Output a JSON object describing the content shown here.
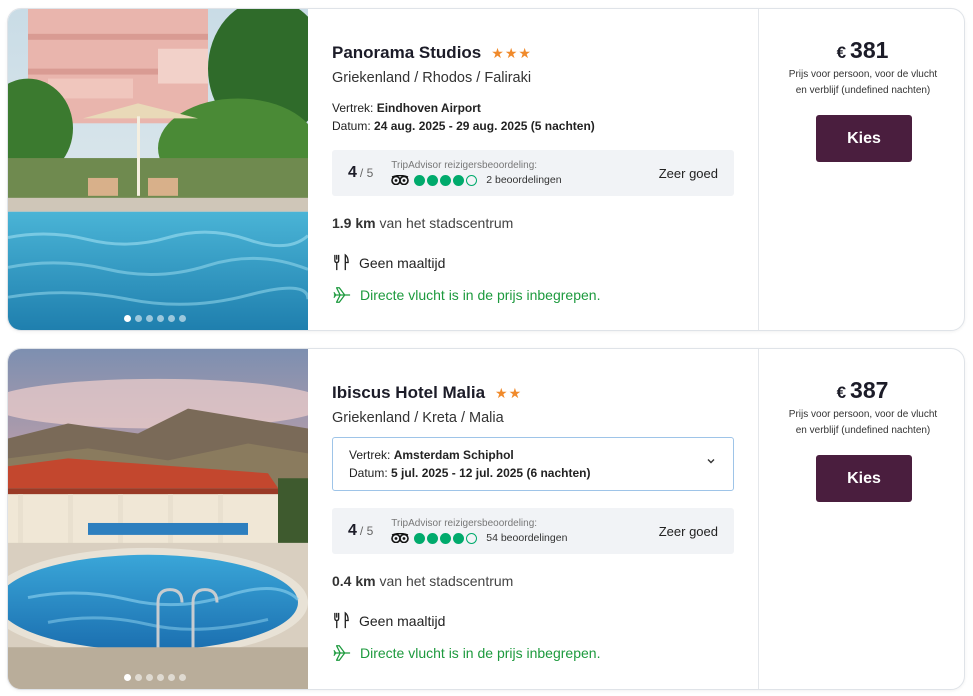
{
  "results": [
    {
      "name": "Panorama Studios",
      "stars": "★★★",
      "location": "Griekenland / Rhodos / Faliraki",
      "departure_label": "Vertrek:",
      "departure": "Eindhoven Airport",
      "date_label": "Datum:",
      "dates": "24 aug. 2025 - 29 aug. 2025 (5 nachten)",
      "rating_score": "4",
      "rating_of": "/ 5",
      "tripadvisor_label": "TripAdvisor reizigersbeoordeling:",
      "bubbles_filled": 4,
      "reviews": "2 beoordelingen",
      "verdict": "Zeer goed",
      "distance_km": "1.9 km",
      "distance_text": "van het stadscentrum",
      "meal": "Geen maaltijd",
      "direct_flight": "Directe vlucht is in de prijs inbegrepen.",
      "currency": "€",
      "price": "381",
      "price_note": "Prijs voor persoon, voor de vlucht en verblijf (undefined nachten)",
      "button": "Kies",
      "photo_dots": 6
    },
    {
      "name": "Ibiscus Hotel Malia",
      "stars": "★★",
      "location": "Griekenland / Kreta / Malia",
      "departure_label": "Vertrek:",
      "departure": "Amsterdam Schiphol",
      "date_label": "Datum:",
      "dates": "5 jul. 2025 - 12 jul. 2025 (6 nachten)",
      "rating_score": "4",
      "rating_of": "/ 5",
      "tripadvisor_label": "TripAdvisor reizigersbeoordeling:",
      "bubbles_filled": 4,
      "reviews": "54 beoordelingen",
      "verdict": "Zeer goed",
      "distance_km": "0.4 km",
      "distance_text": "van het stadscentrum",
      "meal": "Geen maaltijd",
      "direct_flight": "Directe vlucht is in de prijs inbegrepen.",
      "currency": "€",
      "price": "387",
      "price_note": "Prijs voor persoon, voor de vlucht en verblijf (undefined nachten)",
      "button": "Kies",
      "photo_dots": 6
    }
  ],
  "colors": {
    "button_bg": "#4a1e3e",
    "star": "#f08a2b",
    "green": "#1d9a3e",
    "tripadvisor": "#00aa6c"
  }
}
